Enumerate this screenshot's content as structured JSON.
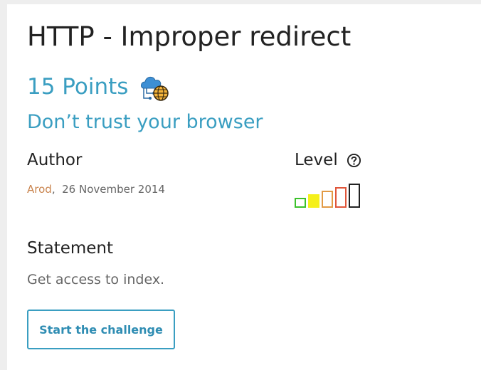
{
  "challenge": {
    "title": "HTTP - Improper redirect",
    "points": "15 Points",
    "category_icon": "cloud-globe-icon",
    "subtitle": "Don’t trust your browser"
  },
  "author": {
    "label": "Author",
    "name": "Arod",
    "separator": ",",
    "date": "26 November 2014"
  },
  "level": {
    "label": "Level",
    "help_icon": "question-circle-icon",
    "current": 2,
    "max": 5,
    "colors": [
      "#3cc22b",
      "#f5f01a",
      "#e29a45",
      "#e0563a",
      "#222222"
    ]
  },
  "statement": {
    "label": "Statement",
    "text": "Get access to index."
  },
  "actions": {
    "start_label": "Start the challenge"
  },
  "colors": {
    "accent": "#3a9ec1",
    "author_name": "#c9844e",
    "text_dark": "#222222",
    "text_muted": "#666666"
  }
}
